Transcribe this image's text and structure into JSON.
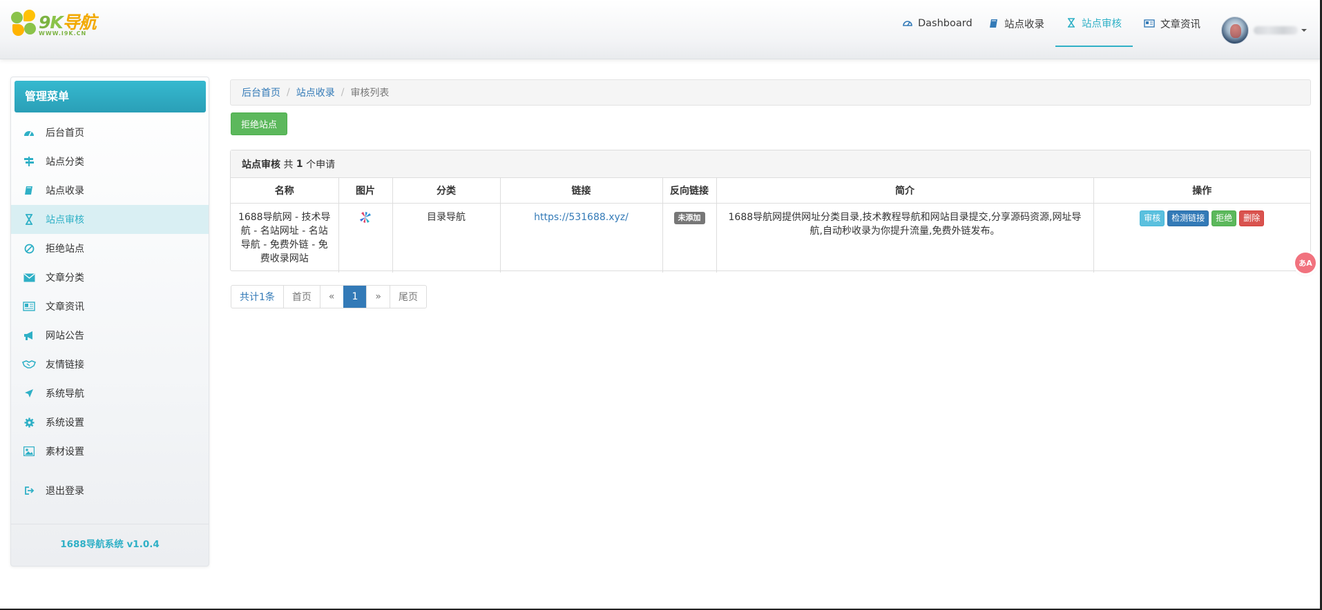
{
  "logo": {
    "name": "9K导航",
    "k": "K",
    "tail": "导航",
    "url": "WWW.I9K.CN"
  },
  "topnav": {
    "items": [
      {
        "label": "Dashboard",
        "icon": "dashboard-icon"
      },
      {
        "label": "站点收录",
        "icon": "book-icon"
      },
      {
        "label": "站点审核",
        "icon": "hourglass-icon",
        "active": true
      },
      {
        "label": "文章资讯",
        "icon": "newspaper-icon"
      }
    ]
  },
  "sidebar": {
    "title": "管理菜单",
    "items": [
      {
        "label": "后台首页",
        "icon": "dashboard-icon"
      },
      {
        "label": "站点分类",
        "icon": "signpost-icon"
      },
      {
        "label": "站点收录",
        "icon": "book-icon"
      },
      {
        "label": "站点审核",
        "icon": "hourglass-icon",
        "active": true
      },
      {
        "label": "拒绝站点",
        "icon": "ban-icon"
      },
      {
        "label": "文章分类",
        "icon": "envelope-icon"
      },
      {
        "label": "文章资讯",
        "icon": "newspaper-icon"
      },
      {
        "label": "网站公告",
        "icon": "bullhorn-icon"
      },
      {
        "label": "友情链接",
        "icon": "handshake-icon"
      },
      {
        "label": "系统导航",
        "icon": "location-arrow-icon"
      },
      {
        "label": "系统设置",
        "icon": "gear-icon"
      },
      {
        "label": "素材设置",
        "icon": "image-icon"
      },
      {
        "label": "退出登录",
        "icon": "sign-out-icon"
      }
    ],
    "footer": "1688导航系统 v1.0.4"
  },
  "breadcrumb": {
    "home": "后台首页",
    "section": "站点收录",
    "current": "审核列表",
    "sep": "/"
  },
  "actions": {
    "reject_sites": "拒绝站点"
  },
  "panel": {
    "title": "站点审核",
    "count_prefix": "共",
    "count": "1",
    "count_suffix": "个申请"
  },
  "table": {
    "headers": [
      "名称",
      "图片",
      "分类",
      "链接",
      "反向链接",
      "简介",
      "操作"
    ],
    "rows": [
      {
        "name": "1688导航网 - 技术导航 - 名站网址 - 名站导航 - 免费外链 - 免费收录网站",
        "category": "目录导航",
        "link": "https://531688.xyz/",
        "backlink": "未添加",
        "intro": "1688导航网提供网址分类目录,技术教程导航和网站目录提交,分享源码资源,网址导航,自动秒收录为你提升流量,免费外链发布。",
        "ops": {
          "review": "审核",
          "check": "检测链接",
          "reject": "拒绝",
          "delete": "删除"
        }
      }
    ]
  },
  "pagination": {
    "total": "共计1条",
    "first": "首页",
    "prev": "«",
    "page": "1",
    "next": "»",
    "last": "尾页"
  },
  "float_badge": "あA",
  "colors": {
    "accent": "#2fb0c6",
    "primary": "#337ab7",
    "success": "#5cb85c",
    "info": "#5bc0de",
    "danger": "#d9534f"
  }
}
